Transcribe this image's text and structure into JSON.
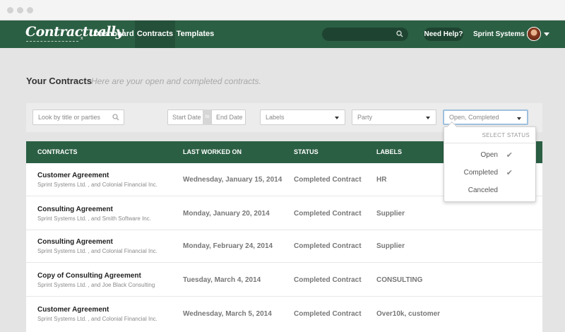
{
  "nav": {
    "logo": "Contractually",
    "logo_mark": "x",
    "links": [
      "Dashboard",
      "Contracts",
      "Templates"
    ],
    "help": "Need Help?",
    "org": "Sprint Systems Ltd."
  },
  "header": {
    "title": "Your Contracts",
    "subtitle": "Here are your open and completed contracts."
  },
  "filters": {
    "search_placeholder": "Look by title or parties",
    "start_date": "Start Date",
    "to": "to",
    "end_date": "End Date",
    "labels": "Labels",
    "party": "Party",
    "status": "Open, Completed"
  },
  "dropdown": {
    "header": "Select Status",
    "options": [
      {
        "label": "Open",
        "check": "✔"
      },
      {
        "label": "Completed",
        "check": "✔"
      },
      {
        "label": "Canceled",
        "check": ""
      }
    ]
  },
  "table": {
    "columns": [
      "Contracts",
      "Last Worked On",
      "Status",
      "Labels"
    ],
    "rows": [
      {
        "name": "Customer Agreement",
        "parties": "Sprint Systems Ltd. , and Colonial Financial Inc.",
        "date": "Wednesday, January 15, 2014",
        "status": "Completed Contract",
        "labels": "HR"
      },
      {
        "name": "Consulting Agreement",
        "parties": "Sprint Systems Ltd. , and Smith Software Inc.",
        "date": "Monday, January 20, 2014",
        "status": "Completed Contract",
        "labels": "Supplier"
      },
      {
        "name": "Consulting Agreement",
        "parties": "Sprint Systems Ltd. , and Colonial Financial Inc.",
        "date": "Monday, February 24, 2014",
        "status": "Completed Contract",
        "labels": "Supplier"
      },
      {
        "name": "Copy of Consulting Agreement",
        "parties": "Sprint Systems Ltd. , and Joe Black Consulting",
        "date": "Tuesday, March 4, 2014",
        "status": "Completed Contract",
        "labels": "CONSULTING"
      },
      {
        "name": "Customer Agreement",
        "parties": "Sprint Systems Ltd. , and Colonial Financial Inc.",
        "date": "Wednesday, March 5, 2014",
        "status": "Completed Contract",
        "labels": "Over10k, customer"
      }
    ]
  },
  "colors": {
    "brand_green": "#2b5f43",
    "background": "#e4e4e4",
    "focus_border": "#9fc1de"
  },
  "icons": [
    "search-icon",
    "dropdown-caret-icon",
    "check-icon",
    "user-menu-caret-icon"
  ]
}
